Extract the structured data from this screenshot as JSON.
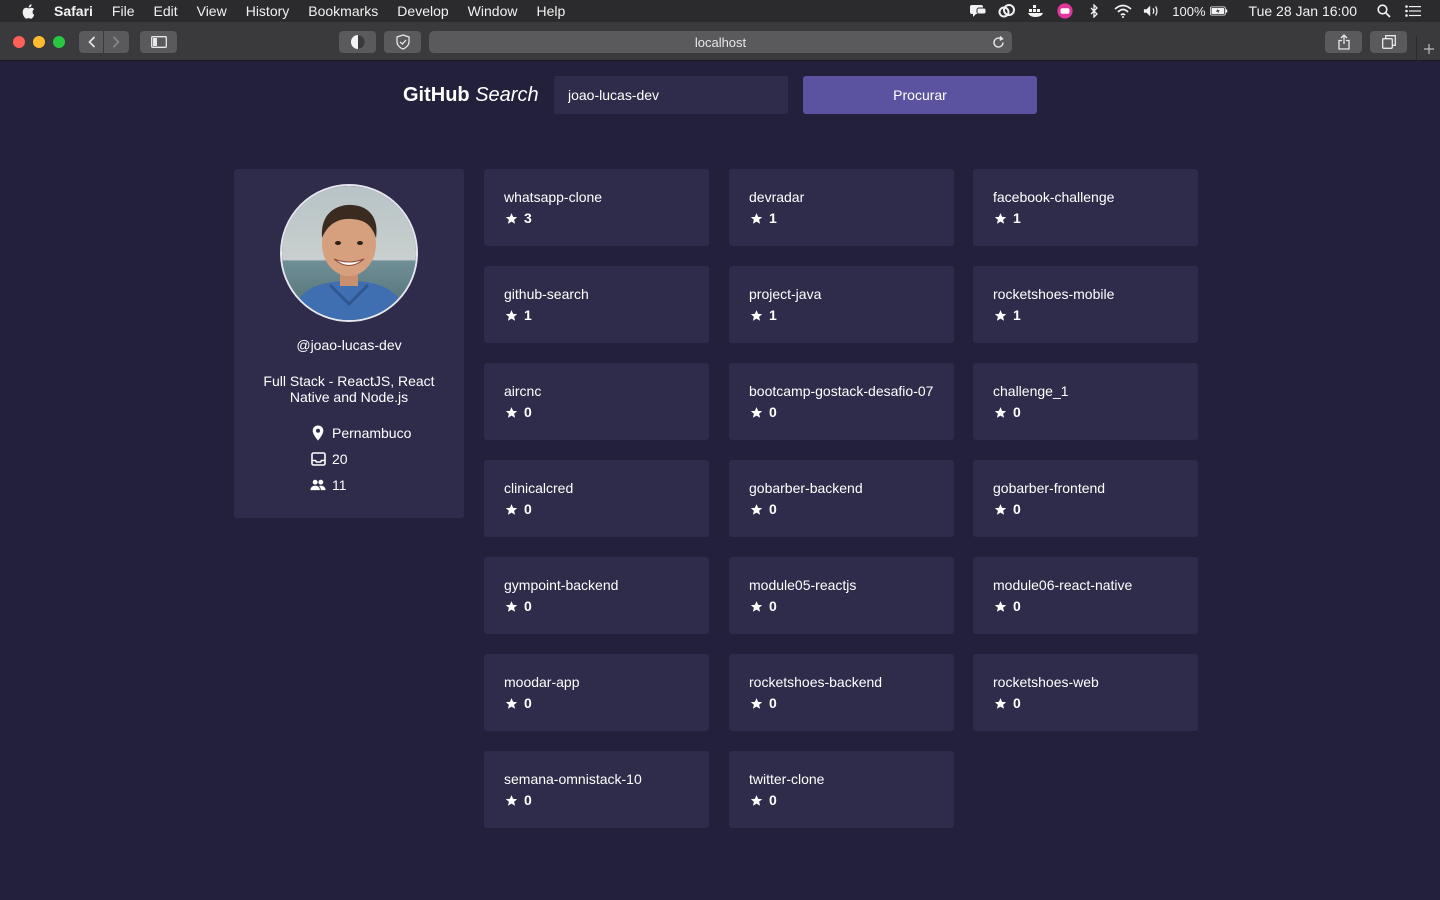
{
  "menubar": {
    "app": "Safari",
    "items": [
      "File",
      "Edit",
      "View",
      "History",
      "Bookmarks",
      "Develop",
      "Window",
      "Help"
    ],
    "battery": "100%",
    "clock": "Tue 28 Jan  16:00"
  },
  "browser": {
    "url": "localhost"
  },
  "header": {
    "brand_main": "GitHub",
    "brand_em": "Search",
    "search_value": "joao-lucas-dev",
    "button_label": "Procurar"
  },
  "profile": {
    "username": "@joao-lucas-dev",
    "bio": "Full Stack - ReactJS, React Native and Node.js",
    "location": "Pernambuco",
    "repos": "20",
    "followers": "11"
  },
  "repos": [
    {
      "name": "whatsapp-clone",
      "stars": "3"
    },
    {
      "name": "devradar",
      "stars": "1"
    },
    {
      "name": "facebook-challenge",
      "stars": "1"
    },
    {
      "name": "github-search",
      "stars": "1"
    },
    {
      "name": "project-java",
      "stars": "1"
    },
    {
      "name": "rocketshoes-mobile",
      "stars": "1"
    },
    {
      "name": "aircnc",
      "stars": "0"
    },
    {
      "name": "bootcamp-gostack-desafio-07",
      "stars": "0"
    },
    {
      "name": "challenge_1",
      "stars": "0"
    },
    {
      "name": "clinicalcred",
      "stars": "0"
    },
    {
      "name": "gobarber-backend",
      "stars": "0"
    },
    {
      "name": "gobarber-frontend",
      "stars": "0"
    },
    {
      "name": "gympoint-backend",
      "stars": "0"
    },
    {
      "name": "module05-reactjs",
      "stars": "0"
    },
    {
      "name": "module06-react-native",
      "stars": "0"
    },
    {
      "name": "moodar-app",
      "stars": "0"
    },
    {
      "name": "rocketshoes-backend",
      "stars": "0"
    },
    {
      "name": "rocketshoes-web",
      "stars": "0"
    },
    {
      "name": "semana-omnistack-10",
      "stars": "0"
    },
    {
      "name": "twitter-clone",
      "stars": "0"
    }
  ],
  "colors": {
    "background": "#22203a",
    "card": "#2e2c4a",
    "accent": "#5b52a0"
  }
}
